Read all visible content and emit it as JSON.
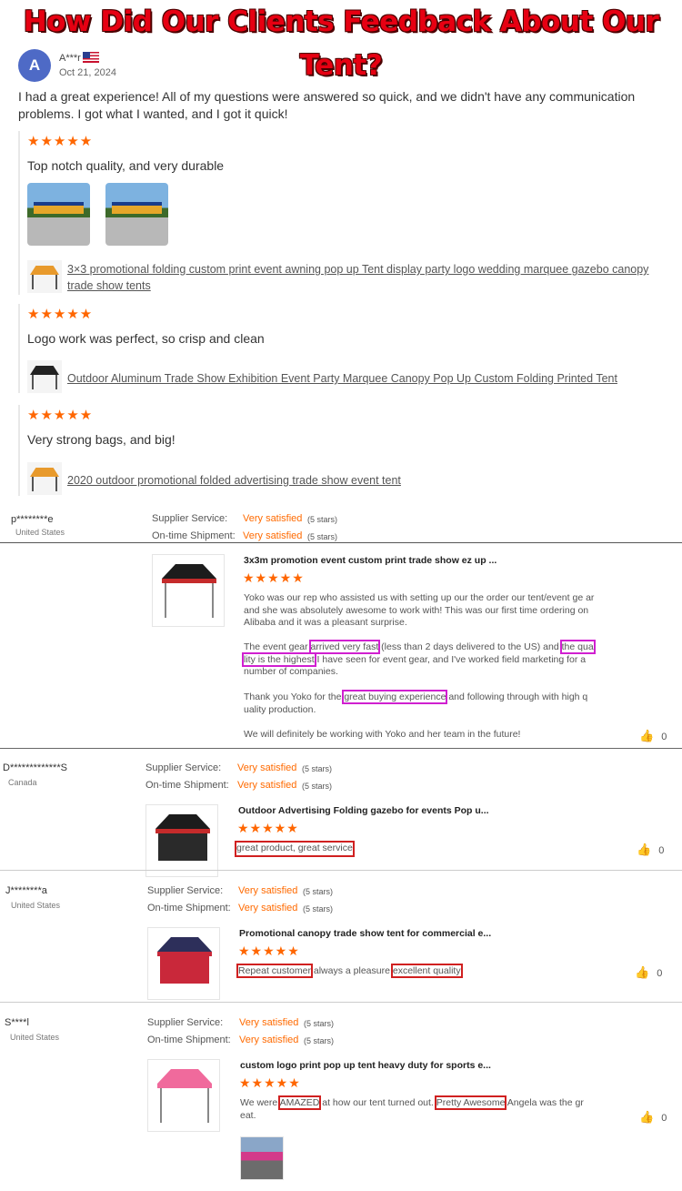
{
  "banner": {
    "title": "How Did Our Clients Feedback About Our Tent?"
  },
  "first_review": {
    "avatar_letter": "A",
    "reviewer": "A***r",
    "date": "Oct 21, 2024",
    "text": "I had a great experience! All of my questions were answered so quick, and we didn't have any communication problems. I got what I wanted, and I got it quick!",
    "stars": "★★★★★",
    "sub_reviews": [
      {
        "stars": "★★★★★",
        "text": "Top notch quality, and very durable",
        "product": "3×3 promotional folding custom print event awning pop up Tent display party logo wedding marquee gazebo canopy trade show tents"
      },
      {
        "stars": "★★★★★",
        "text": "Logo work was perfect, so crisp and clean",
        "product": "Outdoor Aluminum Trade Show Exhibition Event Party Marquee Canopy Pop Up Custom Folding Printed Tent"
      },
      {
        "stars": "★★★★★",
        "text": "Very strong bags, and big!",
        "product": "2020 outdoor promotional folded advertising trade show event tent"
      }
    ]
  },
  "labels": {
    "supplier_service": "Supplier Service:",
    "ontime_shipment": "On-time Shipment:",
    "very_satisfied": "Very satisfied",
    "five_stars": "(5 stars)",
    "stars": "★★★★★"
  },
  "reviews": [
    {
      "user": "p********e",
      "country": "United States",
      "title": "3x3m promotion event custom print trade show ez up ...",
      "p1": "Yoko was our rep who assisted us with setting up our the order our tent/event ge ar and she was absolutely awesome to work with! This was our first time ordering on Alibaba and it was a pleasant surprise.",
      "p2a": "The event gear ",
      "p2b": "arrived very fast",
      "p2c": " (less than 2 days delivered to the US) and ",
      "p2d": "the qua lity is the highest",
      "p2e": " I have seen for event gear, and I've worked field marketing for a number of companies.",
      "p3a": "Thank you Yoko for the ",
      "p3b": "great buying experience",
      "p3c": " and following through with high q uality production.",
      "p4": "We will definitely be working with Yoko and her team in the future!",
      "likes": "0"
    },
    {
      "user": "D*************S",
      "country": "Canada",
      "title": "Outdoor Advertising Folding gazebo for events Pop u...",
      "t1": "great product, great service",
      "likes": "0"
    },
    {
      "user": "J********a",
      "country": "United States",
      "title": "Promotional canopy trade show tent for commercial e...",
      "t1": "Repeat customer",
      "t2": " always a pleasure ",
      "t3": "excellent quality",
      "likes": "0"
    },
    {
      "user": "S****l",
      "country": "United States",
      "title": "custom logo print pop up tent heavy duty for sports e...",
      "t1": "We were ",
      "t2": "AMAZED",
      "t3": " at how our tent turned out. ",
      "t4": "Pretty Awesome",
      "t5": " Angela was the gr eat.",
      "likes": "0"
    }
  ]
}
